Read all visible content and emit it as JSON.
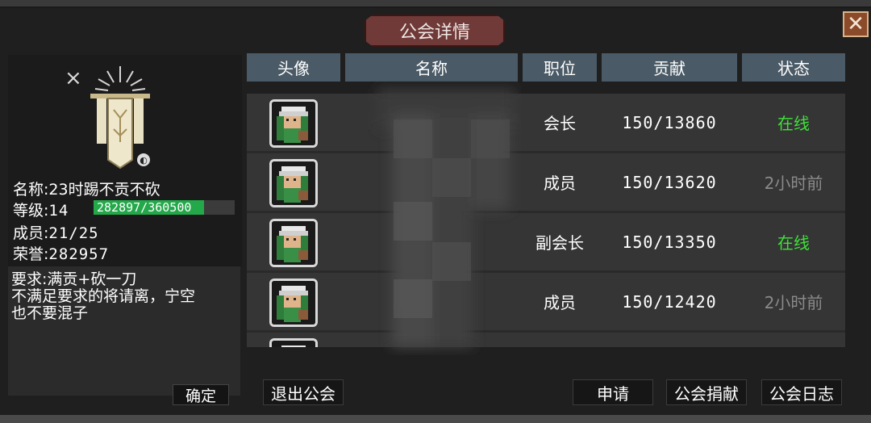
{
  "window": {
    "title": "公会详情",
    "close_label": "✕"
  },
  "guild": {
    "emblem_close": "×",
    "name_label": "名称:",
    "name_value": "23时踢不贡不砍",
    "level_label": "等级:",
    "level_value": "14",
    "exp_text": "282897/360500",
    "exp_progress": 0.785,
    "members_label": "成员:",
    "members_value": "21/25",
    "honor_label": "荣誉:",
    "honor_value": "282957",
    "requirement": "要求:满贡+砍一刀\n不满足要求的将请离，宁空\n也不要混子",
    "confirm_label": "确定"
  },
  "table": {
    "headers": [
      "头像",
      "名称",
      "职位",
      "贡献",
      "状态"
    ],
    "rows": [
      {
        "position": "会长",
        "contribution": "150/13860",
        "status": "在线",
        "online": true
      },
      {
        "position": "成员",
        "contribution": "150/13620",
        "status": "2小时前",
        "online": false
      },
      {
        "position": "副会长",
        "contribution": "150/13350",
        "status": "在线",
        "online": true
      },
      {
        "position": "成员",
        "contribution": "150/12420",
        "status": "2小时前",
        "online": false
      }
    ]
  },
  "buttons": {
    "leave": "退出公会",
    "apply": "申请",
    "donate": "公会捐献",
    "log": "公会日志"
  },
  "colors": {
    "online": "#3fe03a",
    "offline": "#8a8a8a",
    "exp_fill": "#23a84a",
    "header_bg": "#4a5a66",
    "title_bg": "#6f3a37"
  }
}
